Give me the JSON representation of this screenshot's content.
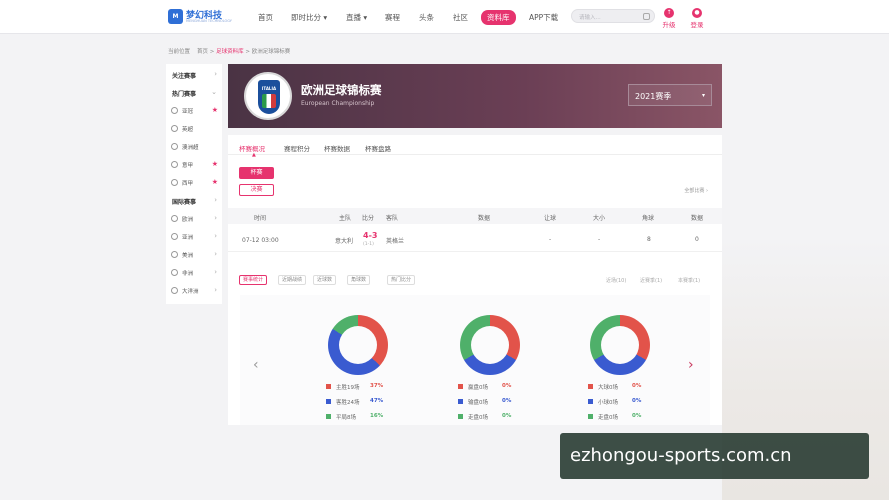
{
  "logo": {
    "mark": "M",
    "name": "梦幻科技",
    "tagline": "MENGHUAN TECHNOLOGY"
  },
  "nav": {
    "items": [
      {
        "label": "首页"
      },
      {
        "label": "即时比分 ▾"
      },
      {
        "label": "直播 ▾"
      },
      {
        "label": "赛程"
      },
      {
        "label": "头条"
      },
      {
        "label": "社区"
      },
      {
        "label": "资料库"
      },
      {
        "label": "APP下载"
      }
    ],
    "search_placeholder": "请输入...",
    "upgrade_label": "升级",
    "login_label": "登录"
  },
  "breadcrumb": {
    "prefix": "当前位置",
    "home": "首页",
    "section": "足球资料库",
    "current": "欧洲足球锦标赛"
  },
  "sidebar": {
    "items": [
      {
        "label": "关注赛事",
        "kind": "hd",
        "mark": "›"
      },
      {
        "label": "热门赛事",
        "kind": "hd",
        "mark": "⌄"
      },
      {
        "label": "亚冠",
        "kind": "sub",
        "mark": "★"
      },
      {
        "label": "英超",
        "kind": "sub",
        "mark": ""
      },
      {
        "label": "澳洲超",
        "kind": "sub",
        "mark": ""
      },
      {
        "label": "意甲",
        "kind": "sub",
        "mark": "★"
      },
      {
        "label": "西甲",
        "kind": "sub",
        "mark": "★"
      },
      {
        "label": "国际赛事",
        "kind": "hd",
        "mark": "›"
      },
      {
        "label": "欧洲",
        "kind": "sub",
        "mark": "›"
      },
      {
        "label": "亚洲",
        "kind": "sub",
        "mark": "›"
      },
      {
        "label": "美洲",
        "kind": "sub",
        "mark": "›"
      },
      {
        "label": "非洲",
        "kind": "sub",
        "mark": "›"
      },
      {
        "label": "大洋洲",
        "kind": "sub",
        "mark": "›"
      }
    ]
  },
  "banner": {
    "badge_text": "ITALIA",
    "title": "欧洲足球锦标赛",
    "subtitle": "European Championship",
    "season": "2021赛季",
    "season_caret": "▾"
  },
  "tabs": [
    {
      "label": "杯赛概况"
    },
    {
      "label": "赛程积分"
    },
    {
      "label": "杯赛数据"
    },
    {
      "label": "杯赛盘路"
    }
  ],
  "stage_buttons": [
    {
      "label": "杯赛"
    },
    {
      "label": "决赛"
    }
  ],
  "more_link": "全部比赛 ›",
  "table": {
    "headers": [
      "时间",
      "主队",
      "比分",
      "客队",
      "数据",
      "让球",
      "大小",
      "角球",
      "数据"
    ],
    "row": {
      "time": "07-12 03:00",
      "home": "意大利",
      "score": "4-3",
      "half": "(1-1)",
      "away": "英格兰",
      "handicap": "-",
      "overunder": "-",
      "corners": "8",
      "data": "0"
    }
  },
  "filters": [
    "赛事统计",
    "近期战绩",
    "近球数",
    "角球数",
    "热门比分"
  ],
  "filters_right": [
    "近场(10)",
    "近赛季(1)",
    "本赛季(1)"
  ],
  "colors": {
    "accent": "#e6336e",
    "red": "#e2534a",
    "blue": "#3a5bd0",
    "green": "#4fb06a"
  },
  "charts": [
    {
      "legend": [
        {
          "label": "主胜19场",
          "pct": "37%",
          "color": "#e2534a"
        },
        {
          "label": "客胜24场",
          "pct": "47%",
          "color": "#3a5bd0"
        },
        {
          "label": "平局8场",
          "pct": "16%",
          "color": "#4fb06a"
        }
      ]
    },
    {
      "legend": [
        {
          "label": "赢盘0场",
          "pct": "0%",
          "color": "#e2534a"
        },
        {
          "label": "输盘0场",
          "pct": "0%",
          "color": "#3a5bd0"
        },
        {
          "label": "走盘0场",
          "pct": "0%",
          "color": "#4fb06a"
        }
      ]
    },
    {
      "legend": [
        {
          "label": "大球0场",
          "pct": "0%",
          "color": "#e2534a"
        },
        {
          "label": "小球0场",
          "pct": "0%",
          "color": "#3a5bd0"
        },
        {
          "label": "走盘0场",
          "pct": "0%",
          "color": "#4fb06a"
        }
      ]
    }
  ],
  "prev_icon": "‹",
  "next_icon": "›",
  "watermark": "ezhongou-sports.com.cn"
}
